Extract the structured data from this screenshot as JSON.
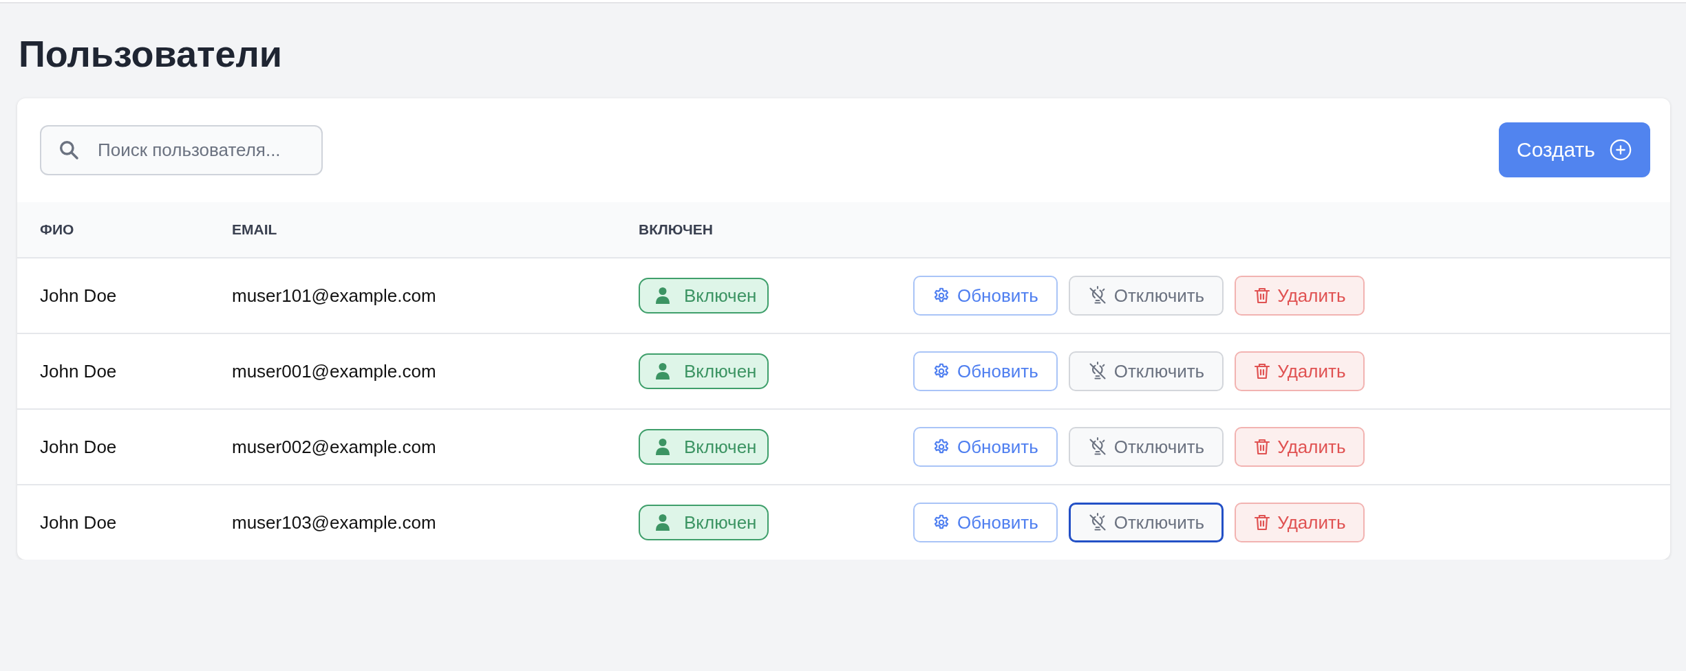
{
  "page_title": "Пользователи",
  "search": {
    "placeholder": "Поиск пользователя..."
  },
  "create_button": {
    "label": "Создать"
  },
  "table": {
    "columns": [
      "ФИО",
      "EMAIL",
      "ВКЛЮЧЕН"
    ],
    "rows": [
      {
        "name": "John Doe",
        "email": "muser101@example.com",
        "status": {
          "label": "Включен",
          "on": true
        },
        "actions": [
          {
            "kind": "update",
            "label": "Обновить",
            "focused": false
          },
          {
            "kind": "disable",
            "label": "Отключить",
            "focused": false
          },
          {
            "kind": "delete",
            "label": "Удалить",
            "focused": false
          }
        ]
      },
      {
        "name": "John Doe",
        "email": "muser001@example.com",
        "status": {
          "label": "Включен",
          "on": true
        },
        "actions": [
          {
            "kind": "update",
            "label": "Обновить",
            "focused": false
          },
          {
            "kind": "disable",
            "label": "Отключить",
            "focused": false
          },
          {
            "kind": "delete",
            "label": "Удалить",
            "focused": false
          }
        ]
      },
      {
        "name": "John Doe",
        "email": "muser002@example.com",
        "status": {
          "label": "Включен",
          "on": true
        },
        "actions": [
          {
            "kind": "update",
            "label": "Обновить",
            "focused": false
          },
          {
            "kind": "disable",
            "label": "Отключить",
            "focused": false
          },
          {
            "kind": "delete",
            "label": "Удалить",
            "focused": false
          }
        ]
      },
      {
        "name": "John Doe",
        "email": "muser103@example.com",
        "status": {
          "label": "Включен",
          "on": true
        },
        "actions": [
          {
            "kind": "update",
            "label": "Обновить",
            "focused": false
          },
          {
            "kind": "disable",
            "label": "Отключить",
            "focused": true
          },
          {
            "kind": "delete",
            "label": "Удалить",
            "focused": false
          }
        ]
      }
    ]
  }
}
